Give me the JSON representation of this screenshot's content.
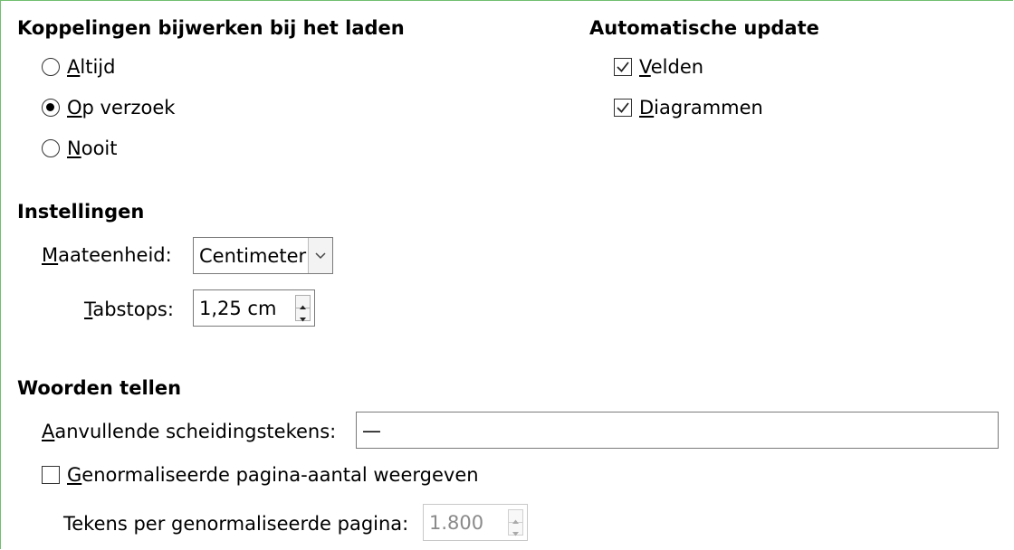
{
  "links": {
    "heading": "Koppelingen bijwerken bij het laden",
    "options": [
      {
        "label": "Altijd",
        "selected": false
      },
      {
        "label": "Op verzoek",
        "selected": true
      },
      {
        "label": "Nooit",
        "selected": false
      }
    ]
  },
  "auto_update": {
    "heading": "Automatische update",
    "fields": {
      "label": "Velden",
      "checked": true
    },
    "charts": {
      "label": "Diagrammen",
      "checked": true
    }
  },
  "settings": {
    "heading": "Instellingen",
    "unit_label": "Maateenheid:",
    "unit_value": "Centimeter",
    "tab_label": "Tabstops:",
    "tab_value": "1,25 cm"
  },
  "word_count": {
    "heading": "Woorden tellen",
    "separators_label": "Aanvullende scheidingstekens:",
    "separators_value": "—",
    "normalized_label": "Genormaliseerde pagina-aantal weergeven",
    "normalized_checked": false,
    "chars_label": "Tekens per genormaliseerde pagina:",
    "chars_value": "1.800"
  },
  "colors": {
    "border": "#6fbf6f",
    "field_border": "#7a7a7a",
    "disabled_text": "#8a8a8a"
  },
  "icons": [
    "radio-icon",
    "checkbox-check-icon",
    "chevron-down-icon",
    "spin-up-icon",
    "spin-down-icon"
  ]
}
